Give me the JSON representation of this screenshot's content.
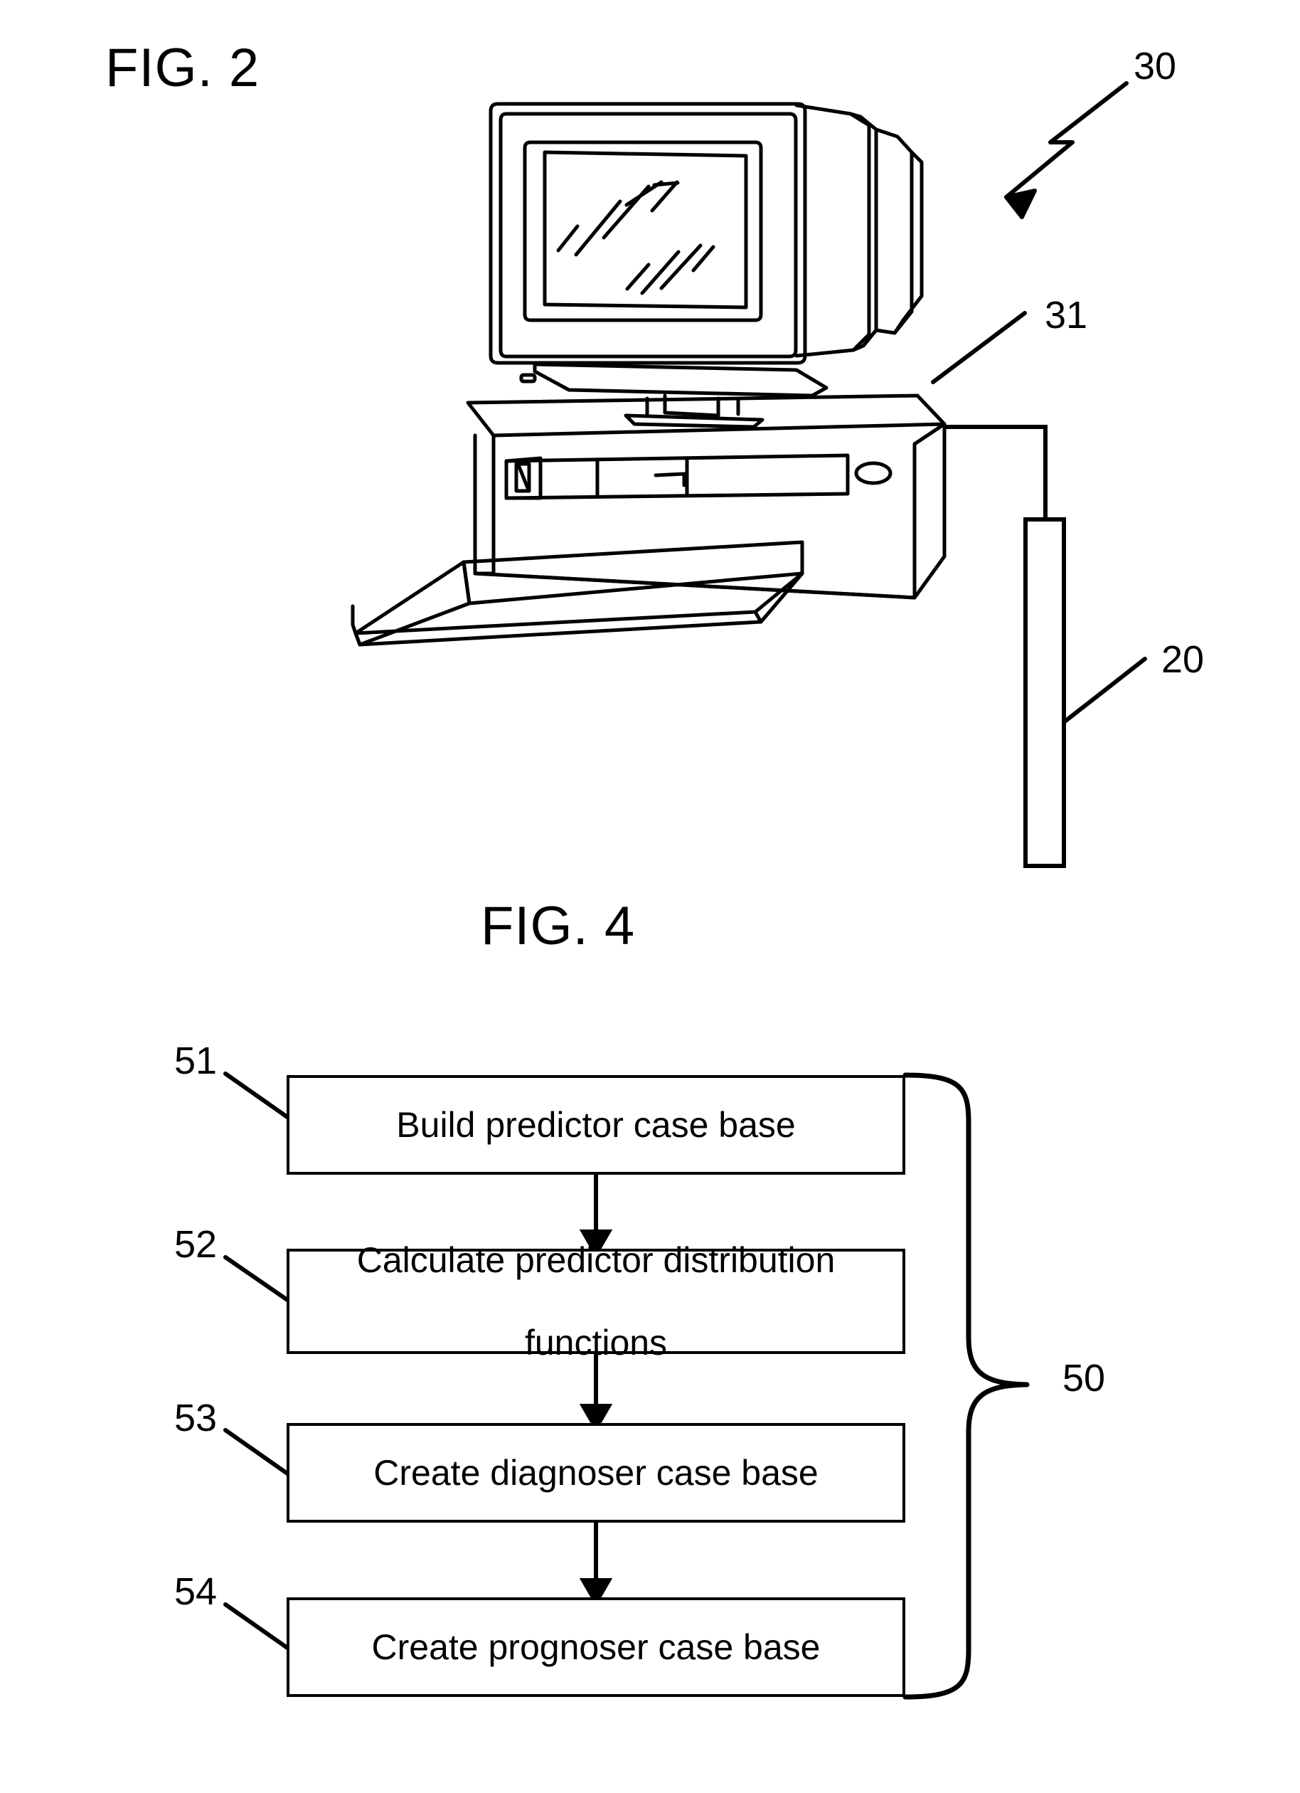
{
  "figures": {
    "fig2": {
      "label": "FIG. 2",
      "callouts": {
        "system": "30",
        "computer": "31",
        "device": "20"
      },
      "parts": {
        "monitor": "crt-monitor",
        "tower": "desktop-computer-tower",
        "keyboard": "keyboard",
        "cable": "connection-cable",
        "probe": "vertical-bar-device"
      }
    },
    "fig4": {
      "label": "FIG. 4",
      "group_callout": "50",
      "steps": [
        {
          "ref": "51",
          "text": "Build predictor case base"
        },
        {
          "ref": "52",
          "text": "Calculate predictor distribution\nfunctions",
          "line1": "Calculate predictor distribution",
          "line2": "functions"
        },
        {
          "ref": "53",
          "text": "Create diagnoser case base"
        },
        {
          "ref": "54",
          "text": "Create prognoser case base"
        }
      ]
    }
  },
  "colors": {
    "ink": "#000000",
    "paper": "#ffffff"
  }
}
